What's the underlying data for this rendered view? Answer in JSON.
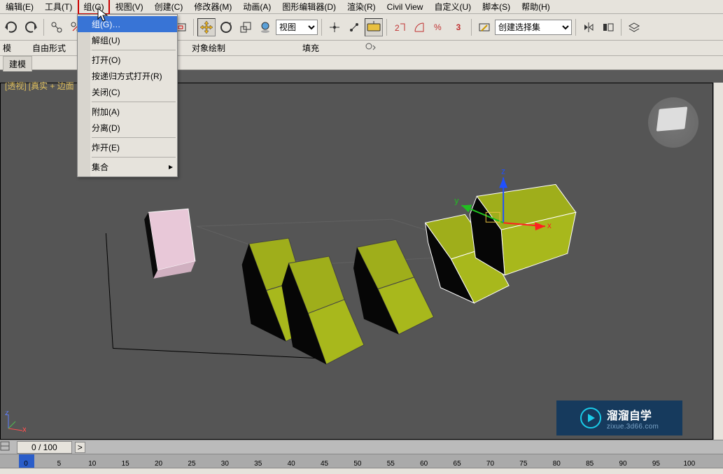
{
  "menubar": [
    "编辑(E)",
    "工具(T)",
    "组(G)",
    "视图(V)",
    "创建(C)",
    "修改器(M)",
    "动画(A)",
    "图形编辑器(D)",
    "渲染(R)",
    "Civil View",
    "自定义(U)",
    "脚本(S)",
    "帮助(H)"
  ],
  "menubar_active_index": 2,
  "dropdown_items": [
    {
      "label": "组(G)…",
      "highlighted": true
    },
    {
      "label": "解组(U)"
    },
    {
      "sep": true
    },
    {
      "label": "打开(O)"
    },
    {
      "label": "按递归方式打开(R)"
    },
    {
      "label": "关闭(C)"
    },
    {
      "sep": true
    },
    {
      "label": "附加(A)"
    },
    {
      "label": "分离(D)"
    },
    {
      "sep": true
    },
    {
      "label": "炸开(E)"
    },
    {
      "sep": true
    },
    {
      "label": "集合",
      "submenu": true
    }
  ],
  "toolbar": {
    "ref_select_label": "视图",
    "named_sel": "创建选择集",
    "spinner_value": "3"
  },
  "ribbon": {
    "labels": [
      "模",
      "自由形式",
      "对象绘制",
      "填充"
    ],
    "tab": "建模"
  },
  "viewport": {
    "label_perspective": "[透视]",
    "label_shading": "[真实 + 边面"
  },
  "time": {
    "slider": "0 / 100",
    "fwd": ">",
    "ticks": [
      "0",
      "5",
      "10",
      "15",
      "20",
      "25",
      "30",
      "35",
      "40",
      "45",
      "50",
      "55",
      "60",
      "65",
      "70",
      "75",
      "80",
      "85",
      "90",
      "95",
      "100"
    ]
  },
  "watermark": {
    "line1": "溜溜自学",
    "line2": "zixue.3d66.com"
  }
}
